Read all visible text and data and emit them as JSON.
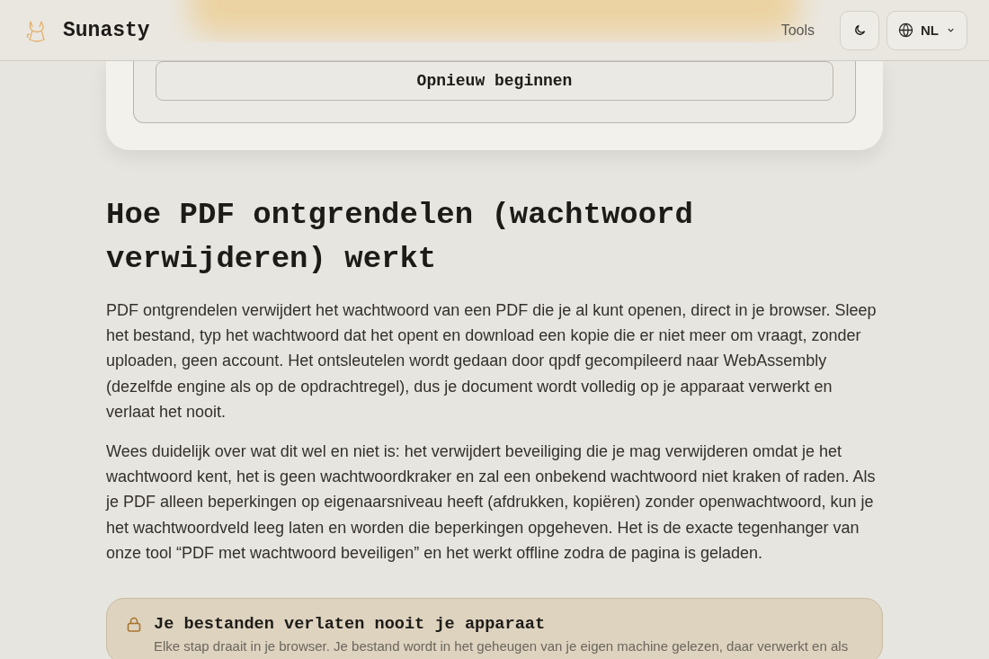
{
  "header": {
    "brand": "Sunasty",
    "nav": [
      {
        "label": "Tools"
      }
    ],
    "language": "NL"
  },
  "tool_card": {
    "button": "Opnieuw beginnen"
  },
  "article": {
    "title": "Hoe PDF ontgrendelen (wachtwoord verwijderen) werkt",
    "paragraphs": [
      "PDF ontgrendelen verwijdert het wachtwoord van een PDF die je al kunt openen, direct in je browser. Sleep het bestand, typ het wachtwoord dat het opent en download een kopie die er niet meer om vraagt, zonder uploaden, geen account. Het ontsleutelen wordt gedaan door qpdf gecompileerd naar WebAssembly (dezelfde engine als op de opdrachtregel), dus je document wordt volledig op je apparaat verwerkt en verlaat het nooit.",
      "Wees duidelijk over wat dit wel en niet is: het verwijdert beveiliging die je mag verwijderen omdat je het wachtwoord kent, het is geen wachtwoordkraker en zal een onbekend wachtwoord niet kraken of raden. Als je PDF alleen beperkingen op eigenaarsniveau heeft (afdrukken, kopiëren) zonder openwachtwoord, kun je het wachtwoordveld leeg laten en worden die beperkingen opgeheven. Het is de exacte tegenhanger van onze tool “PDF met wachtwoord beveiligen” en het werkt offline zodra de pagina is geladen."
    ]
  },
  "privacy_box": {
    "title": "Je bestanden verlaten nooit je apparaat",
    "text": "Elke stap draait in je browser. Je bestand wordt in het geheugen van je eigen machine gelezen, daar verwerkt en als"
  }
}
